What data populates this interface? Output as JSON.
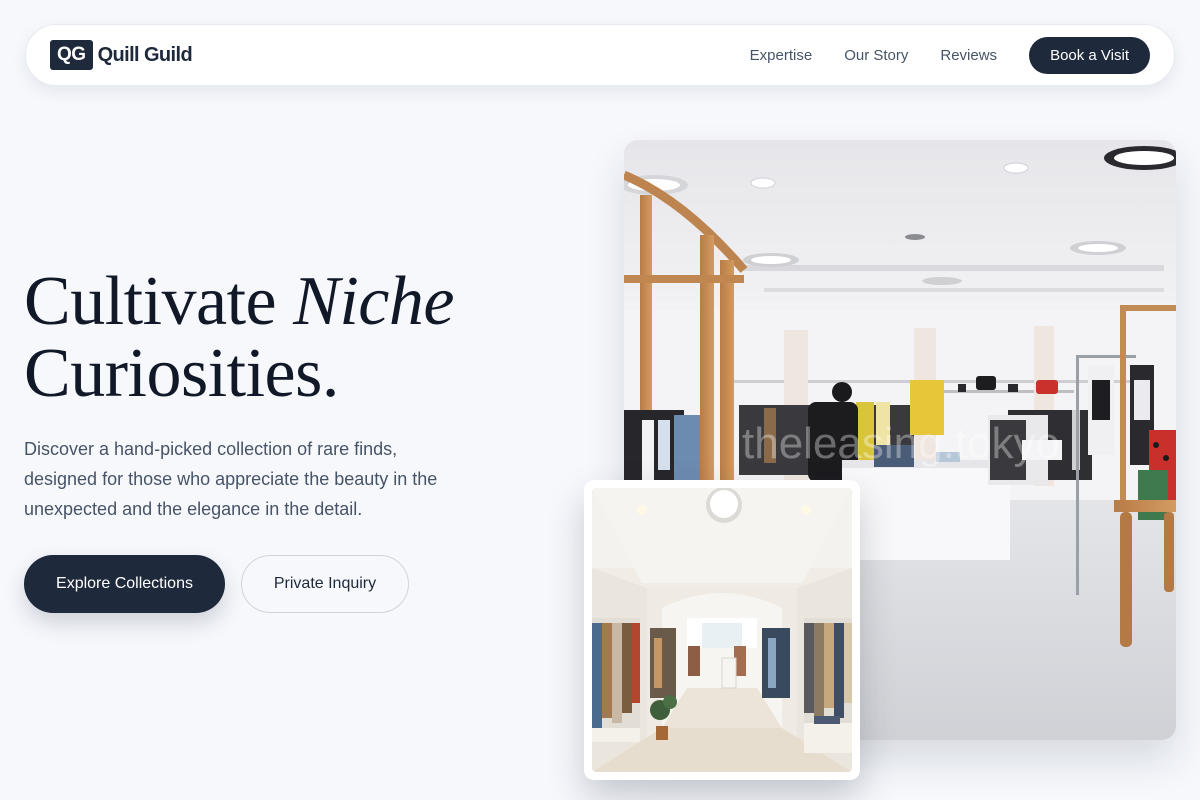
{
  "nav": {
    "logo_mark": "QG",
    "brand_name": "Quill Guild",
    "links": [
      "Expertise",
      "Our Story",
      "Reviews"
    ],
    "cta_label": "Book a Visit"
  },
  "hero": {
    "title_part1": "Cultivate ",
    "title_emphasis": "Niche",
    "title_part2": "Curiosities.",
    "description": "Discover a hand-picked collection of rare finds, designed for those who appreciate the beauty in the unexpected and the elegance in the detail.",
    "primary_button": "Explore Collections",
    "secondary_button": "Private Inquiry"
  },
  "images": {
    "main_alt": "Bright boutique interior with clothing racks",
    "inset_alt": "Narrow clothing shop corridor with racks"
  },
  "colors": {
    "background": "#f6f8fc",
    "accent_dark": "#1e293b",
    "text_muted": "#475467"
  }
}
